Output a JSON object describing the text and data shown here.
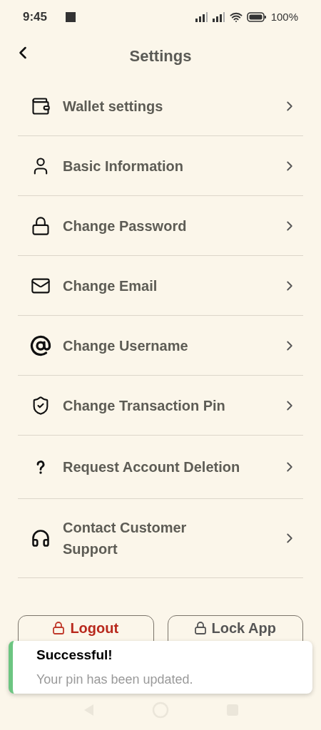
{
  "status_bar": {
    "time": "9:45",
    "battery": "100%"
  },
  "header": {
    "title": "Settings"
  },
  "items": [
    {
      "label": "Wallet settings"
    },
    {
      "label": "Basic Information"
    },
    {
      "label": "Change Password"
    },
    {
      "label": "Change Email"
    },
    {
      "label": "Change Username"
    },
    {
      "label": "Change Transaction Pin"
    },
    {
      "label": "Request Account Deletion"
    },
    {
      "label": "Contact Customer Support"
    }
  ],
  "buttons": [
    {
      "kind": "danger",
      "label": "Logout"
    },
    {
      "kind": "normal",
      "label": "Lock App"
    }
  ],
  "toast": {
    "title": "Successful!",
    "message": "Your pin has been updated."
  }
}
